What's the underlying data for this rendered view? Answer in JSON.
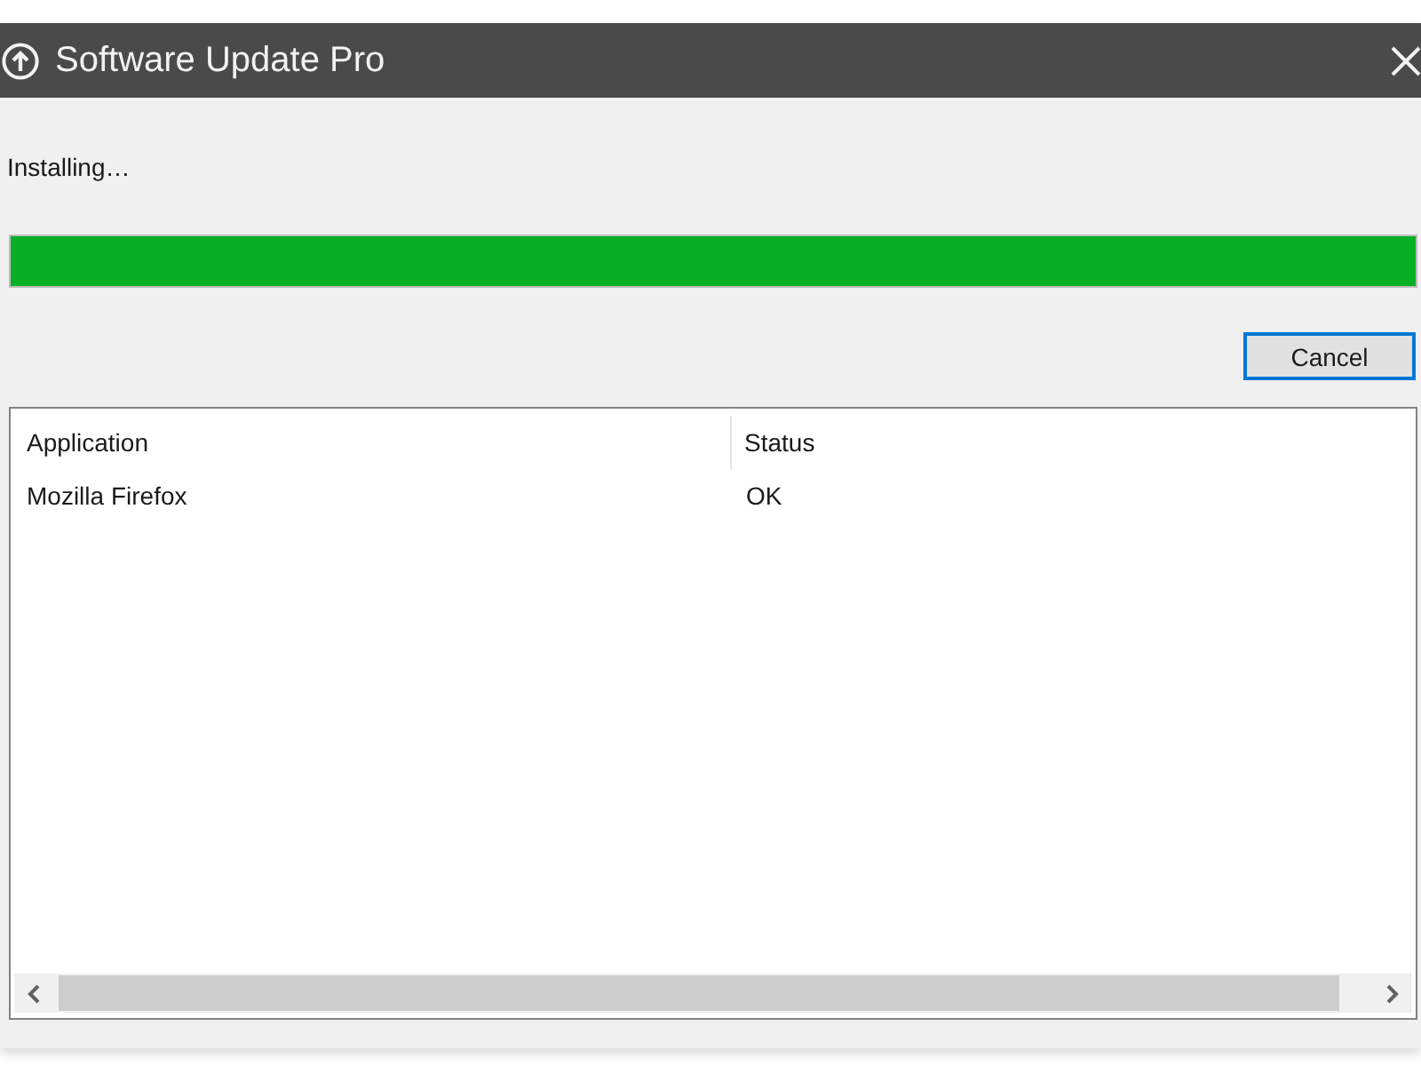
{
  "window": {
    "title": "Software Update Pro"
  },
  "status_text": "Installing…",
  "progress": {
    "level": 1
  },
  "buttons": [
    {
      "label": "Cancel",
      "focused": true
    }
  ],
  "table": {
    "columns": [
      "Application",
      "Status"
    ],
    "rows": [
      [
        "Mozilla Firefox",
        "OK"
      ]
    ]
  }
}
